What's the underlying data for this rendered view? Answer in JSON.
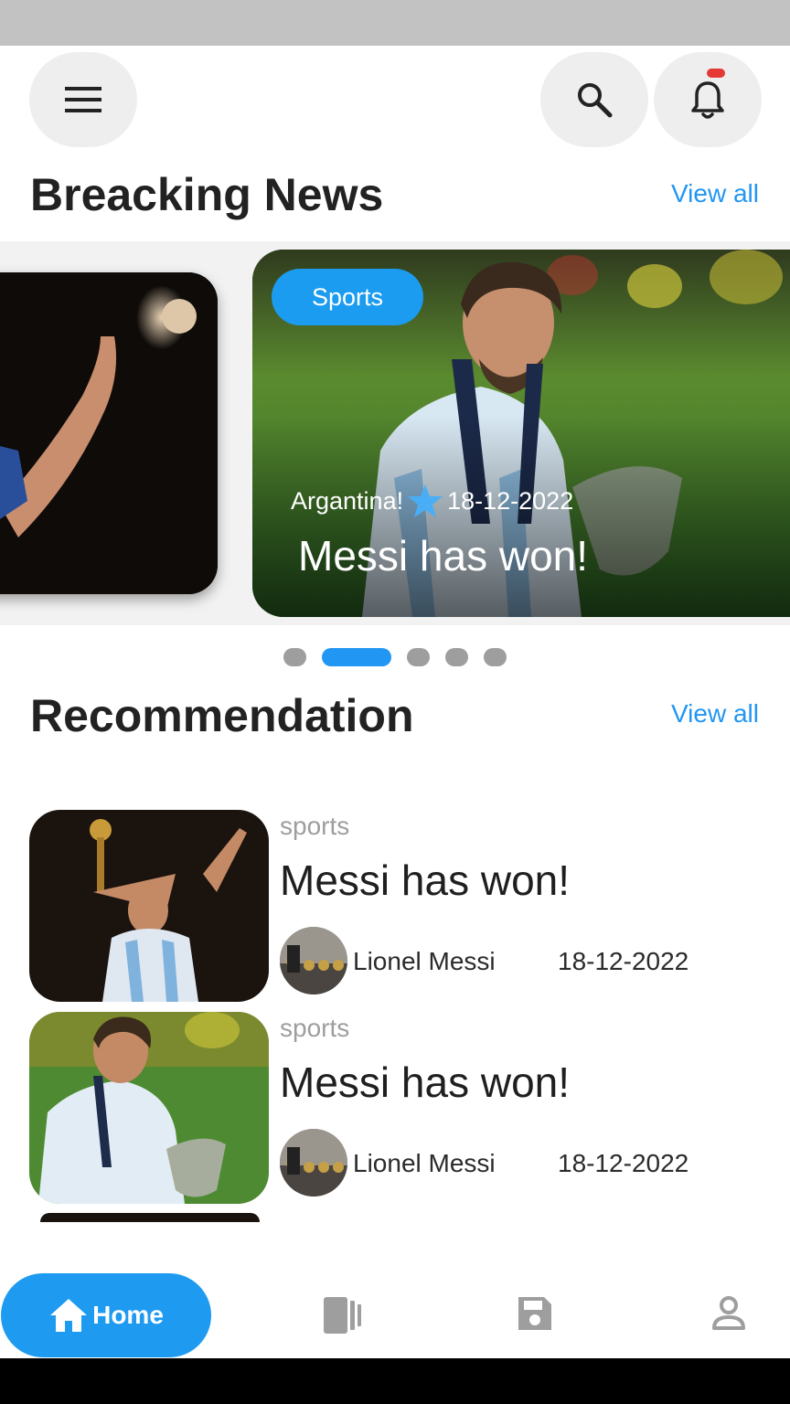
{
  "header": {
    "menu_icon": "menu-icon",
    "search_icon": "search-icon",
    "notification_icon": "bell-icon"
  },
  "breaking": {
    "title": "Breacking News",
    "view_all": "View all",
    "featured": {
      "badge": "Sports",
      "location": "Argantina!",
      "date": "18-12-2022",
      "headline": "Messi has won!"
    },
    "pagination": {
      "count": 5,
      "active_index": 1
    }
  },
  "recommendation": {
    "title": "Recommendation",
    "view_all": "View all",
    "items": [
      {
        "category": "sports",
        "headline": "Messi has won!",
        "author": "Lionel Messi",
        "date": "18-12-2022"
      },
      {
        "category": "sports",
        "headline": "Messi has won!",
        "author": "Lionel Messi",
        "date": "18-12-2022"
      }
    ]
  },
  "bottom_nav": {
    "home_label": "Home",
    "items": [
      "home-icon",
      "articles-icon",
      "save-icon",
      "profile-icon"
    ]
  },
  "colors": {
    "accent": "#2196f3",
    "badge": "#1b9cf0",
    "notification": "#e53935"
  }
}
